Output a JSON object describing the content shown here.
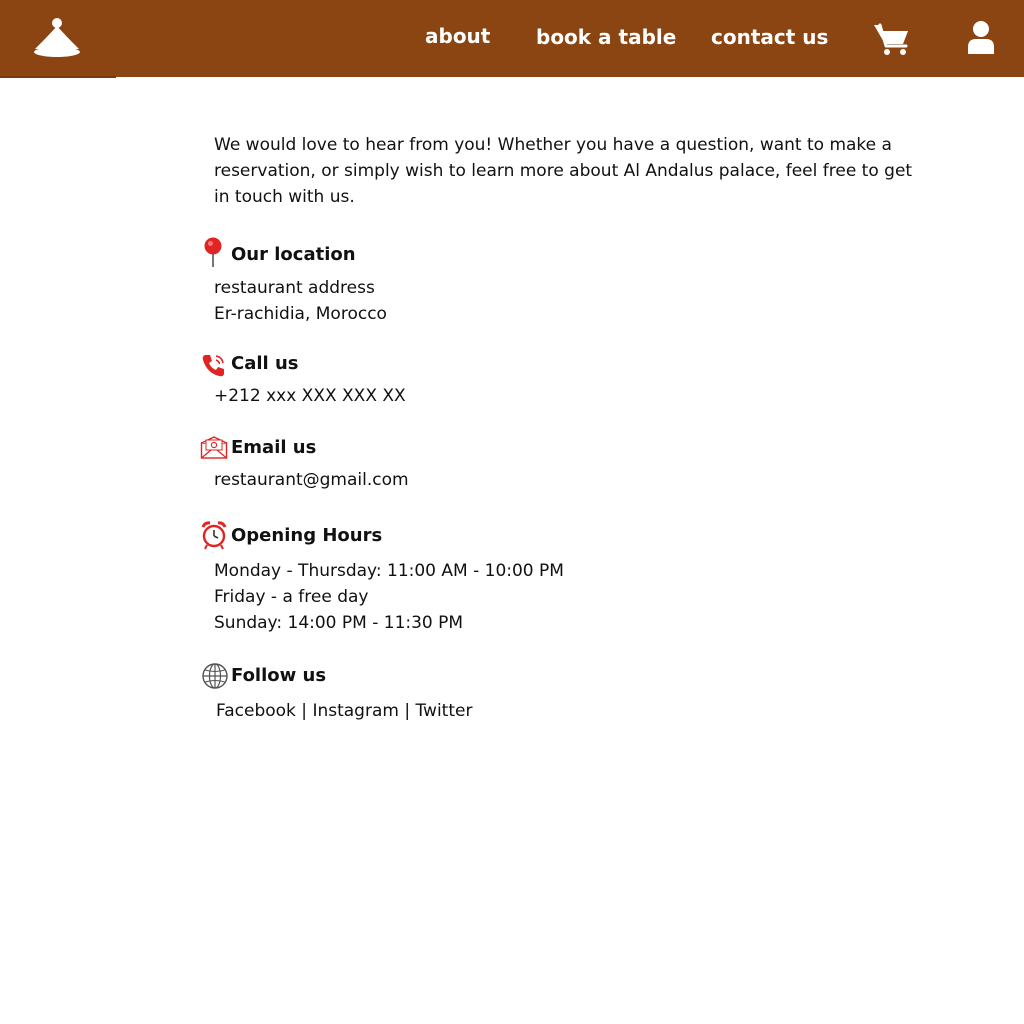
{
  "nav": {
    "about": "about",
    "book_table": "book a table",
    "contact_us": "contact us",
    "cart_icon": "cart-icon",
    "user_icon": "user-icon",
    "logo_icon": "tagine-logo-icon"
  },
  "colors": {
    "navbar_bg": "#8B4513",
    "nav_text": "#FFFFFF",
    "icon_red": "#E02424"
  },
  "intro": "We would love to hear from you! Whether you have a question, want to make a reservation, or simply wish to learn more about Al Andalus palace, feel free to get in touch with us.",
  "location": {
    "heading": "Our location",
    "line1": "restaurant address",
    "line2": "Er-rachidia, Morocco",
    "icon": "map-pin-icon"
  },
  "call": {
    "heading": "Call us",
    "phone": "+212 xxx XXX XXX XX",
    "icon": "phone-icon"
  },
  "email": {
    "heading": "Email us",
    "address": "restaurant@gmail.com",
    "icon": "envelope-icon"
  },
  "hours": {
    "heading": "Opening Hours",
    "line1": "Monday - Thursday: 11:00 AM - 10:00 PM",
    "line2": "Friday - a free day",
    "line3": "Sunday: 14:00 PM - 11:30 PM",
    "icon": "alarm-clock-icon"
  },
  "follow": {
    "heading": "Follow us",
    "facebook": "Facebook",
    "instagram": "Instagram",
    "twitter": "Twitter",
    "separator": "|",
    "icon": "globe-icon"
  }
}
